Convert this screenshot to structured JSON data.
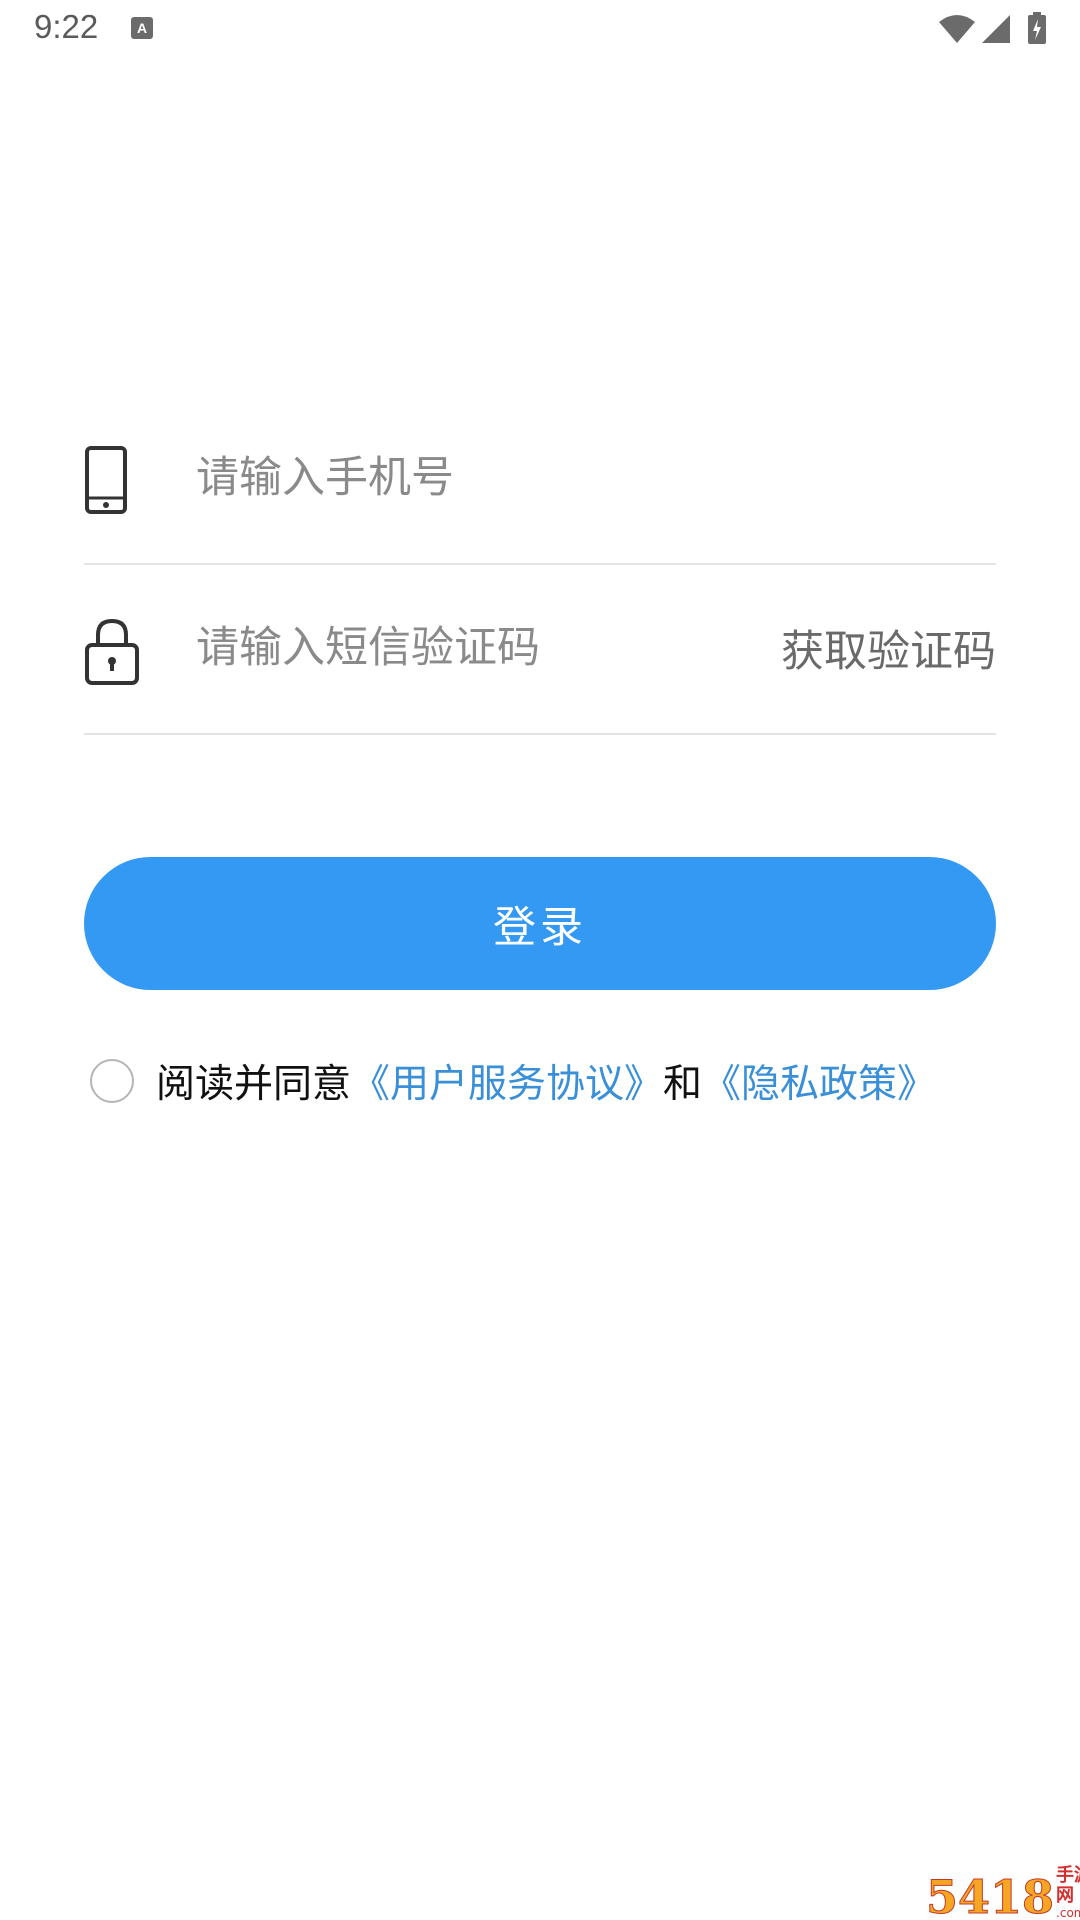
{
  "status_bar": {
    "time": "9:22",
    "app_icon": "a-letter-icon",
    "wifi_icon": "wifi-icon",
    "signal_icon": "cellular-signal-icon",
    "battery_icon": "battery-charging-icon"
  },
  "form": {
    "phone": {
      "icon": "phone-icon",
      "placeholder": "请输入手机号",
      "value": ""
    },
    "code": {
      "icon": "lock-icon",
      "placeholder": "请输入短信验证码",
      "value": "",
      "get_code_label": "获取验证码"
    }
  },
  "login_button": {
    "label": "登录",
    "color": "#3399f3"
  },
  "agreement": {
    "checked": false,
    "prefix": "阅读并同意",
    "terms_link": "《用户服务协议》",
    "and": "和",
    "privacy_link": "《隐私政策》",
    "link_color": "#3a8fd9"
  },
  "watermark": {
    "number": "5418",
    "site_cn": "手游网",
    "site_domain": ".com.cn"
  }
}
